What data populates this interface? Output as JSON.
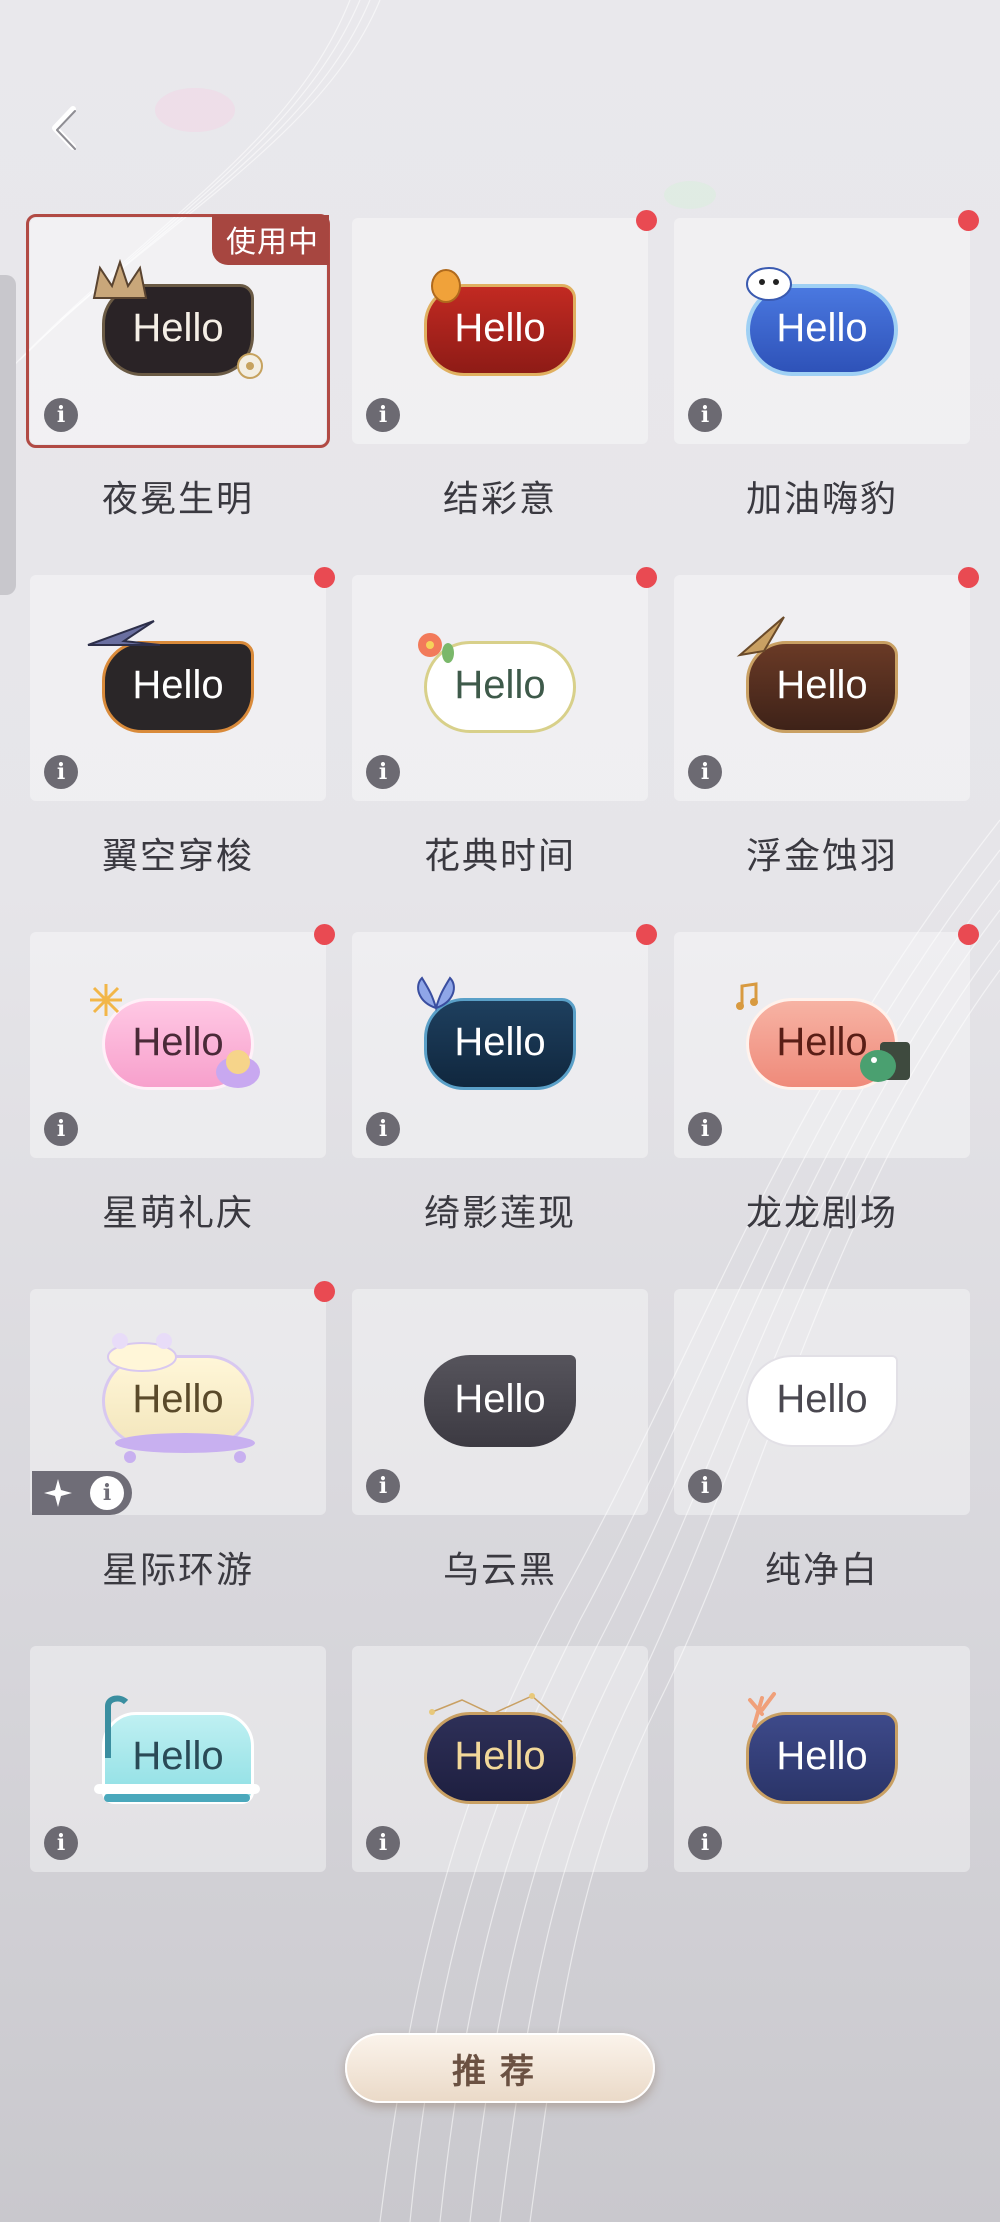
{
  "theme": {
    "accent": "#a74640",
    "badge_dot": "#e94a52",
    "label_text": "#3a3940"
  },
  "header": {
    "back_icon": "chevron-left-icon"
  },
  "status_badge": "使用中",
  "preview_text": "Hello",
  "bubbles": [
    {
      "label": "夜冕生明",
      "selected": true,
      "new": false,
      "style": "dark-crown"
    },
    {
      "label": "结彩意",
      "selected": false,
      "new": true,
      "style": "red-lantern"
    },
    {
      "label": "加油嗨豹",
      "selected": false,
      "new": true,
      "style": "blue-cheer"
    },
    {
      "label": "翼空穿梭",
      "selected": false,
      "new": true,
      "style": "dark-wing"
    },
    {
      "label": "花典时间",
      "selected": false,
      "new": true,
      "style": "white-flower"
    },
    {
      "label": "浮金蚀羽",
      "selected": false,
      "new": true,
      "style": "brown-gold"
    },
    {
      "label": "星萌礼庆",
      "selected": false,
      "new": true,
      "style": "pink-cute"
    },
    {
      "label": "绮影莲现",
      "selected": false,
      "new": true,
      "style": "navy-lotus"
    },
    {
      "label": "龙龙剧场",
      "selected": false,
      "new": true,
      "style": "coral-dragon"
    },
    {
      "label": "星际环游",
      "selected": false,
      "new": true,
      "style": "cream-space"
    },
    {
      "label": "乌云黑",
      "selected": false,
      "new": false,
      "style": "plain-black"
    },
    {
      "label": "纯净白",
      "selected": false,
      "new": false,
      "style": "plain-white"
    },
    {
      "label": "",
      "selected": false,
      "new": false,
      "style": "bathtub"
    },
    {
      "label": "",
      "selected": false,
      "new": false,
      "style": "star-navy"
    },
    {
      "label": "",
      "selected": false,
      "new": false,
      "style": "coral-navy"
    }
  ],
  "recommend_button": "推荐"
}
